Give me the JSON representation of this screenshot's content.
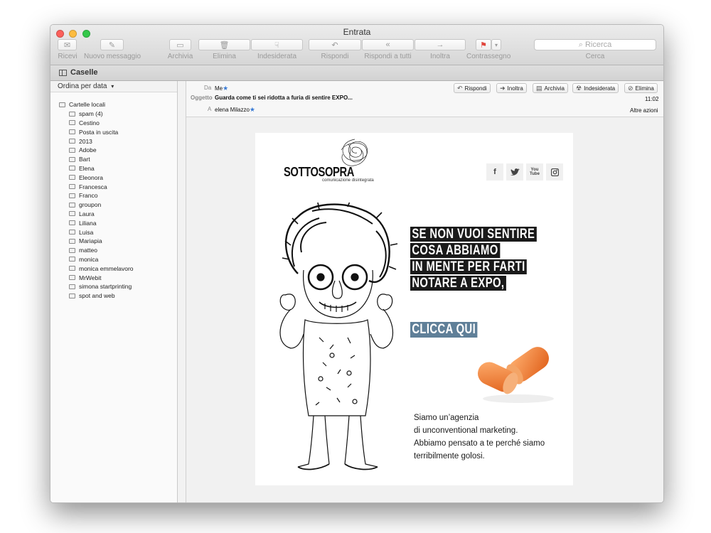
{
  "window": {
    "title": "Entrata"
  },
  "toolbar": {
    "receive": "Ricevi",
    "new_message": "Nuovo messaggio",
    "archive": "Archivia",
    "delete": "Elimina",
    "junk": "Indesiderata",
    "reply": "Rispondi",
    "reply_all": "Rispondi a tutti",
    "forward": "Inoltra",
    "flag": "Contrassegno",
    "search_label": "Cerca",
    "search_placeholder": "Ricerca"
  },
  "favorites": {
    "mailboxes": "Caselle"
  },
  "sidebar": {
    "sort": "Ordina per data",
    "root": "Cartelle locali",
    "folders": [
      "spam (4)",
      "Cestino",
      "Posta in uscita",
      "2013",
      "Adobe",
      "Bart",
      "Elena",
      "Eleonora",
      "Francesca",
      "Franco",
      "groupon",
      "Laura",
      "Liliana",
      "Luisa",
      "Mariapia",
      "matteo",
      "monica",
      "monica emmelavoro",
      "MrWebit",
      "simona startprinting",
      "spot and web"
    ]
  },
  "message": {
    "from_label": "Da",
    "from": "Me",
    "subject_label": "Oggetto",
    "subject": "Guarda come ti sei ridotta a furia di sentire EXPO...",
    "to_label": "A",
    "to": "elena Milazzo",
    "time": "11:02",
    "more_actions": "Altre azioni",
    "buttons": {
      "reply": "Rispondi",
      "forward": "Inoltra",
      "archive": "Archivia",
      "junk": "Indesiderata",
      "delete": "Elimina"
    }
  },
  "email": {
    "brand": "SOTTOSOPRA",
    "tagline": "comunicazione disintegrata",
    "social": [
      "f",
      "twitter",
      "YouTube",
      "instagram"
    ],
    "headline": [
      "SE NON VUOI SENTIRE",
      "COSA ABBIAMO",
      "IN MENTE PER FARTI",
      "NOTARE A EXPO,"
    ],
    "cta": "CLICCA QUI",
    "body": [
      "Siamo un’agenzia",
      "di unconventional marketing.",
      "Abbiamo pensato a te perché siamo",
      "terribilmente golosi."
    ]
  },
  "colors": {
    "cta_bg": "#5f7f98",
    "headline_bg": "#1a1a1a",
    "earplug": "#f07a2a"
  }
}
